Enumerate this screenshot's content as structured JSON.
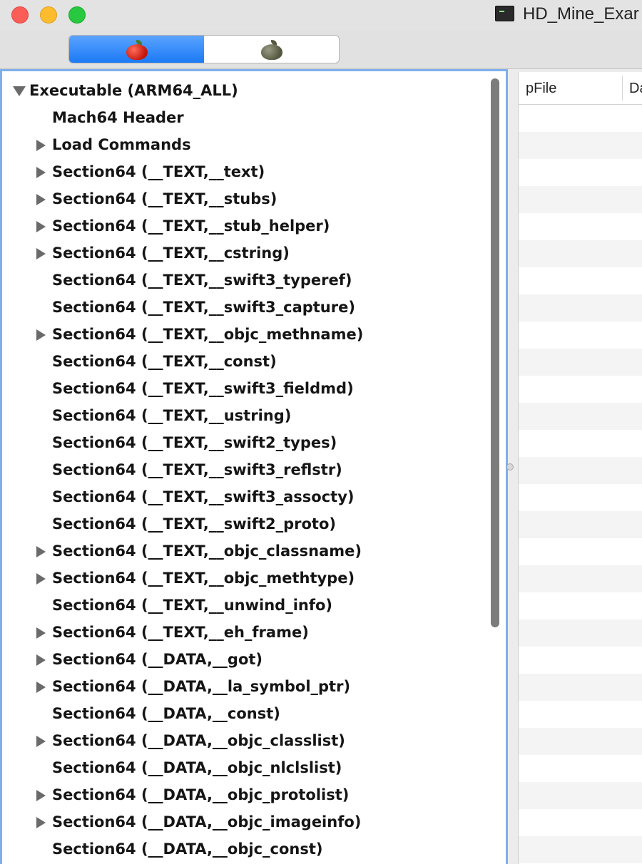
{
  "window": {
    "title": "HD_Mine_Exar"
  },
  "toolbar": {
    "segments": [
      {
        "icon": "red-apple-icon",
        "selected": true
      },
      {
        "icon": "gray-apple-icon",
        "selected": false
      }
    ]
  },
  "tree": {
    "items": [
      {
        "label": "Executable  (ARM64_ALL)",
        "level": 0,
        "expander": "expanded"
      },
      {
        "label": "Mach64 Header",
        "level": 1,
        "expander": "none"
      },
      {
        "label": "Load Commands",
        "level": 1,
        "expander": "collapsed"
      },
      {
        "label": "Section64 (__TEXT,__text)",
        "level": 1,
        "expander": "collapsed"
      },
      {
        "label": "Section64 (__TEXT,__stubs)",
        "level": 1,
        "expander": "collapsed"
      },
      {
        "label": "Section64 (__TEXT,__stub_helper)",
        "level": 1,
        "expander": "collapsed"
      },
      {
        "label": "Section64 (__TEXT,__cstring)",
        "level": 1,
        "expander": "collapsed"
      },
      {
        "label": "Section64 (__TEXT,__swift3_typeref)",
        "level": 1,
        "expander": "none"
      },
      {
        "label": "Section64 (__TEXT,__swift3_capture)",
        "level": 1,
        "expander": "none"
      },
      {
        "label": "Section64 (__TEXT,__objc_methname)",
        "level": 1,
        "expander": "collapsed"
      },
      {
        "label": "Section64 (__TEXT,__const)",
        "level": 1,
        "expander": "none"
      },
      {
        "label": "Section64 (__TEXT,__swift3_fieldmd)",
        "level": 1,
        "expander": "none"
      },
      {
        "label": "Section64 (__TEXT,__ustring)",
        "level": 1,
        "expander": "none"
      },
      {
        "label": "Section64 (__TEXT,__swift2_types)",
        "level": 1,
        "expander": "none"
      },
      {
        "label": "Section64 (__TEXT,__swift3_reflstr)",
        "level": 1,
        "expander": "none"
      },
      {
        "label": "Section64 (__TEXT,__swift3_assocty)",
        "level": 1,
        "expander": "none"
      },
      {
        "label": "Section64 (__TEXT,__swift2_proto)",
        "level": 1,
        "expander": "none"
      },
      {
        "label": "Section64 (__TEXT,__objc_classname)",
        "level": 1,
        "expander": "collapsed"
      },
      {
        "label": "Section64 (__TEXT,__objc_methtype)",
        "level": 1,
        "expander": "collapsed"
      },
      {
        "label": "Section64 (__TEXT,__unwind_info)",
        "level": 1,
        "expander": "none"
      },
      {
        "label": "Section64 (__TEXT,__eh_frame)",
        "level": 1,
        "expander": "collapsed"
      },
      {
        "label": "Section64 (__DATA,__got)",
        "level": 1,
        "expander": "collapsed"
      },
      {
        "label": "Section64 (__DATA,__la_symbol_ptr)",
        "level": 1,
        "expander": "collapsed"
      },
      {
        "label": "Section64 (__DATA,__const)",
        "level": 1,
        "expander": "none"
      },
      {
        "label": "Section64 (__DATA,__objc_classlist)",
        "level": 1,
        "expander": "collapsed"
      },
      {
        "label": "Section64 (__DATA,__objc_nlclslist)",
        "level": 1,
        "expander": "none"
      },
      {
        "label": "Section64 (__DATA,__objc_protolist)",
        "level": 1,
        "expander": "collapsed"
      },
      {
        "label": "Section64 (__DATA,__objc_imageinfo)",
        "level": 1,
        "expander": "collapsed"
      },
      {
        "label": "Section64 (__DATA,__objc_const)",
        "level": 1,
        "expander": "none"
      }
    ]
  },
  "table": {
    "columns": [
      "pFile",
      "Da"
    ],
    "stripe_color": "#f4f4f4"
  },
  "colors": {
    "selection_border": "#7fb0eb",
    "segment_active": "#1b7af5"
  }
}
